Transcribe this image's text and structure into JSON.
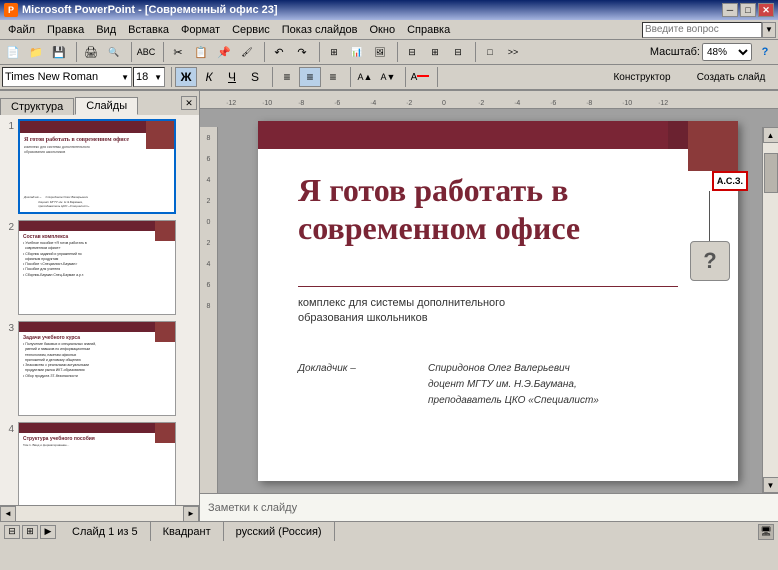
{
  "window": {
    "title": "Microsoft PowerPoint - [Современный офис 23]",
    "icon": "PP"
  },
  "menus": [
    "Файл",
    "Правка",
    "Вид",
    "Вставка",
    "Формат",
    "Сервис",
    "Показ слайдов",
    "Окно",
    "Справка"
  ],
  "search_placeholder": "Введите вопрос",
  "toolbar": {
    "zoom": "48%",
    "font_name": "Times New Roman",
    "font_size": "18",
    "bold": "Ж",
    "italic": "К",
    "underline": "Ч",
    "strikethrough": "S",
    "align_left": "≡",
    "align_center": "≡",
    "align_right": "≡",
    "designer": "Конструктор",
    "new_slide": "Создать слайд"
  },
  "panels": {
    "tab1": "Структура",
    "tab2": "Слайды"
  },
  "slides": [
    {
      "num": "1",
      "title": "Я готов работать в современном офисе",
      "subtitle": "комплекс для системы дополнительного образования школьников"
    },
    {
      "num": "2",
      "title": "Состав комплекса",
      "items": "• Учебное пособие\n• Сборник заданий\n• Пособие для учителя"
    },
    {
      "num": "3",
      "title": "Задачи учебного курса",
      "items": "• Получение базовых и специальных знаний\n• Знакомство с реальными ИКТ-продуктами"
    },
    {
      "num": "4",
      "title": "Структура учебного пособия",
      "items": ""
    }
  ],
  "main_slide": {
    "title_line1": "Я готов работать в",
    "title_line2": "современном офисе",
    "subtitle": "комплекс для системы дополнительного\nобразования школьников",
    "presenter_label": "Докладчик –",
    "presenter_name": "Спиридонов Олег Валерьевич",
    "presenter_detail1": "доцент МГТУ им. Н.Э.Баумана,",
    "presenter_detail2": "преподаватель ЦКО «Специалист»"
  },
  "comment": {
    "label": "А.С.З.",
    "bubble": "?"
  },
  "notes_placeholder": "Заметки к слайду",
  "status": {
    "slide_info": "Слайд 1 из 5",
    "design": "Квадрант",
    "language": "русский (Россия)"
  },
  "ruler": {
    "marks": [
      "-12",
      "-10",
      "-8",
      "-6",
      "-4",
      "-2",
      "0",
      "2",
      "4",
      "6",
      "8",
      "10",
      "12"
    ]
  }
}
